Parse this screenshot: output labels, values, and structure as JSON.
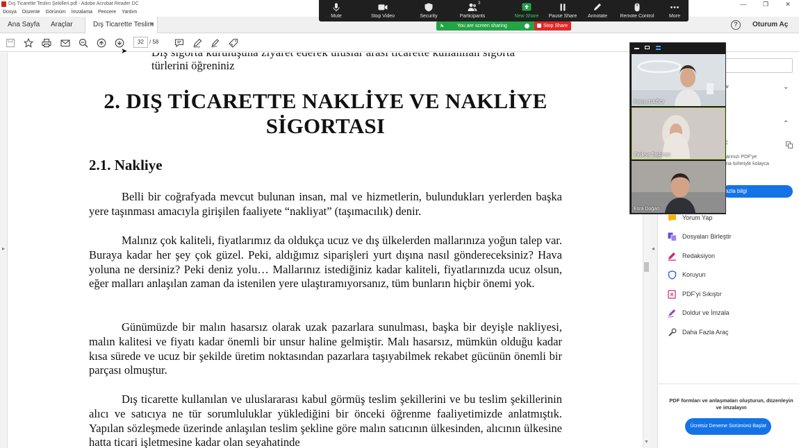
{
  "window": {
    "title": "Dış Ticarette Teslim Şekilleri.pdf - Adobe Acrobat Reader DC",
    "controls": [
      "—",
      "❐",
      "✕"
    ]
  },
  "menu": [
    "Dosya",
    "Düzenle",
    "Görünüm",
    "İmzalama",
    "Pencere",
    "Yardım"
  ],
  "tabs": {
    "home": "Ana Sayfa",
    "tools": "Araçlar",
    "document": "Dış Ticarette Teslim ...",
    "close": "×"
  },
  "header": {
    "signin": "Oturum Aç",
    "help": "?"
  },
  "toolbar": {
    "page_current": "32",
    "page_total": "/ 58"
  },
  "zoom": {
    "buttons": {
      "mute": "Mute",
      "stop_video": "Stop Video",
      "security": "Security",
      "participants": "Participants",
      "participants_count": "3",
      "new_share": "New Share",
      "pause_share": "Pause Share",
      "annotate": "Annotate",
      "remote_control": "Remote Control",
      "more": "More"
    },
    "sharing_banner": "You are screen sharing",
    "stop_share": "Stop Share",
    "accent_green": "#24a347",
    "stop_red": "#e02828"
  },
  "video": {
    "participants": [
      {
        "name": "Fatma DAĞCI"
      },
      {
        "name": "Firdevs Taşbıran"
      },
      {
        "name": "Esra Doğan"
      }
    ]
  },
  "document": {
    "bullet_line1": "Dış sigorta kuruluşuna ziyaret ederek uluslar arası ticarette kullanılan sigorta",
    "bullet_line2": "türlerini öğreniniz",
    "heading1": "2. DIŞ TİCARETTE NAKLİYE VE NAKLİYE SİGORTASI",
    "heading2": "2.1. Nakliye",
    "paragraphs": [
      "Belli bir coğrafyada mevcut bulunan insan, mal ve hizmetlerin, bulundukları yerlerden başka yere taşınması amacıyla girişilen faaliyete “nakliyat” (taşımacılık) denir.",
      "Malınız çok kaliteli, fiyatlarımız da oldukça ucuz ve dış ülkelerden mallarınıza yoğun talep var. Buraya kadar her şey çok güzel. Peki, aldığımız siparişleri yurt dışına nasıl göndereceksiniz? Hava yoluna ne dersiniz? Peki deniz yolu… Mallarınız istediğiniz kadar kaliteli, fiyatlarınızda ucuz olsun, eğer malları anlaşılan zaman da istenilen yere ulaştıramıyorsanız, tüm bunların hiçbir önemi yok.",
      "Günümüzde bir malın hasarsız olarak uzak pazarlara sunulması, başka bir deyişle nakliyesi, malın kalitesi ve fiyatı kadar önemli bir unsur haline gelmiştir. Malı hasarsız, mümkün olduğu kadar kısa sürede ve ucuz bir şekilde üretim noktasından pazarlara taşıyabilmek rekabet gücünün önemli bir parçası olmuştur.",
      "Dış ticarette kullanılan ve uluslararası kabul görmüş teslim şekillerini ve bu teslim şekillerinin alıcı ve satıcıya ne tür sorumluluklar yüklediğini bir önceki öğrenme faaliyetimizde anlatmıştık. Yapılan sözleşmede üzerinde anlaşılan teslim şekline göre malın satıcının ülkesinden, alıcının ülkesine hatta ticari işletmesine kadar olan seyahatinde"
    ]
  },
  "right_pane": {
    "fragment1": "ar",
    "fragment2": "C",
    "fragment3_line1": "arınızı PDF'ye",
    "fragment3_line2": "na türleriyle kolayca",
    "learn_more": "azla bilgi",
    "tools": [
      {
        "label": "Yorum Yap",
        "icon": "comment-icon",
        "color": "#f5b400"
      },
      {
        "label": "Dosyaları Birleştir",
        "icon": "combine-icon",
        "color": "#6e4bd3"
      },
      {
        "label": "Redaksiyon",
        "icon": "redact-icon",
        "color": "#d6246e"
      },
      {
        "label": "Koruyun",
        "icon": "shield-icon",
        "color": "#3e63dd"
      },
      {
        "label": "PDF'yi Sıkıştır",
        "icon": "compress-icon",
        "color": "#d6246e"
      },
      {
        "label": "Doldur ve İmzala",
        "icon": "sign-icon",
        "color": "#8a4bd3"
      },
      {
        "label": "Daha Fazla Araç",
        "icon": "tools-icon",
        "color": "#555555"
      }
    ],
    "promo": "PDF formları ve anlaşmaları oluşturun, düzenleyin ve imzalayın",
    "trial_button": "Ücretsiz Deneme Sürümünü Başlat"
  }
}
